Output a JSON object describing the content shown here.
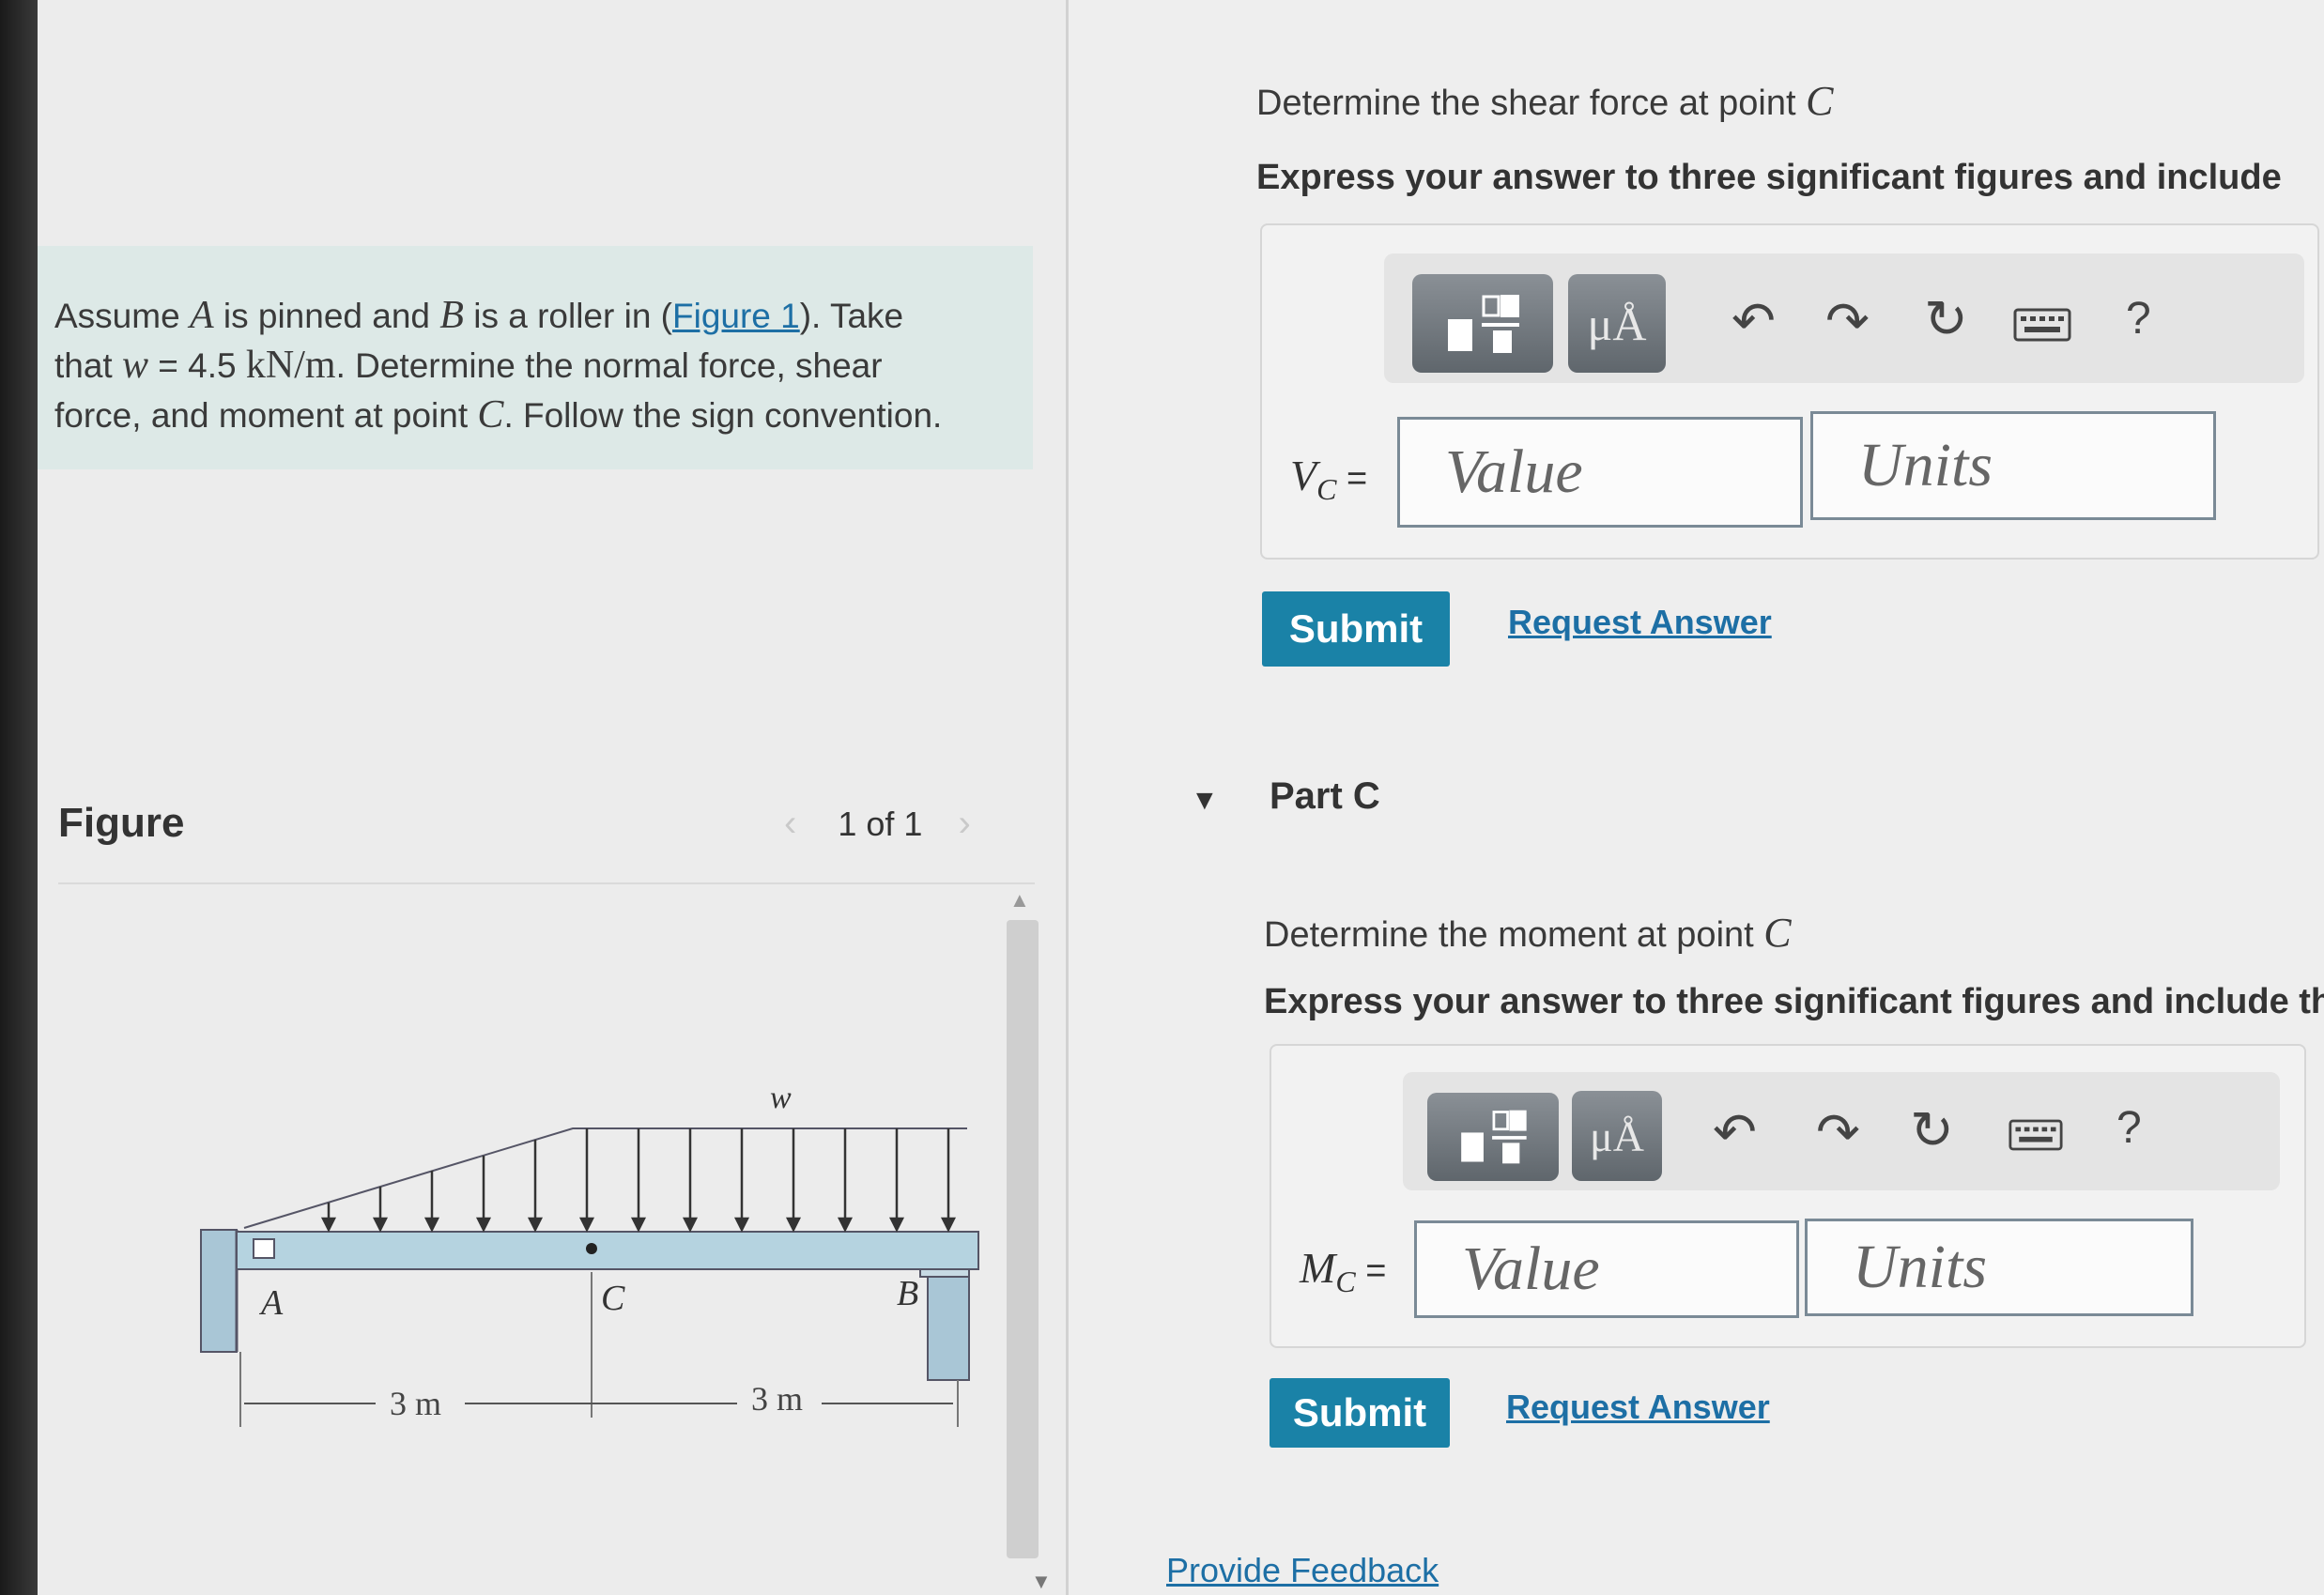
{
  "problem": {
    "t1": "Assume ",
    "a": "A",
    "t2": " is pinned and ",
    "b": "B",
    "t3": " is a roller in (",
    "figure_link": "Figure 1",
    "t4": "). Take",
    "t5": "that ",
    "w": "w",
    "t6": " = 4.5 ",
    "unit": "kN/m",
    "t7": ". Determine the normal force, shear",
    "t8": "force, and moment at point ",
    "c": "C",
    "t9": ". Follow the sign convention."
  },
  "figure": {
    "title": "Figure",
    "nav_prev": "‹",
    "nav_count": "1 of 1",
    "nav_next": "›",
    "labels": {
      "w": "w",
      "a": "A",
      "c": "C",
      "b": "B",
      "d1": "3 m",
      "d2": "3 m"
    }
  },
  "part_b": {
    "prompt": "Determine the shear force at point ",
    "point": "C",
    "instruction": "Express your answer to three significant figures and include",
    "var": "V",
    "sub": "C",
    "eq": " =",
    "value_placeholder": "Value",
    "units_placeholder": "Units",
    "submit": "Submit",
    "request": "Request Answer"
  },
  "part_c": {
    "title": "Part C",
    "prompt": "Determine the moment at point ",
    "point": "C",
    "instruction": "Express your answer to three significant figures and include th",
    "var": "M",
    "sub": "C",
    "eq": " =",
    "value_placeholder": "Value",
    "units_placeholder": "Units",
    "submit": "Submit",
    "request": "Request Answer"
  },
  "toolbar": {
    "mu_label": "μÅ",
    "help": "?"
  },
  "footer": {
    "feedback": "Provide Feedback"
  }
}
